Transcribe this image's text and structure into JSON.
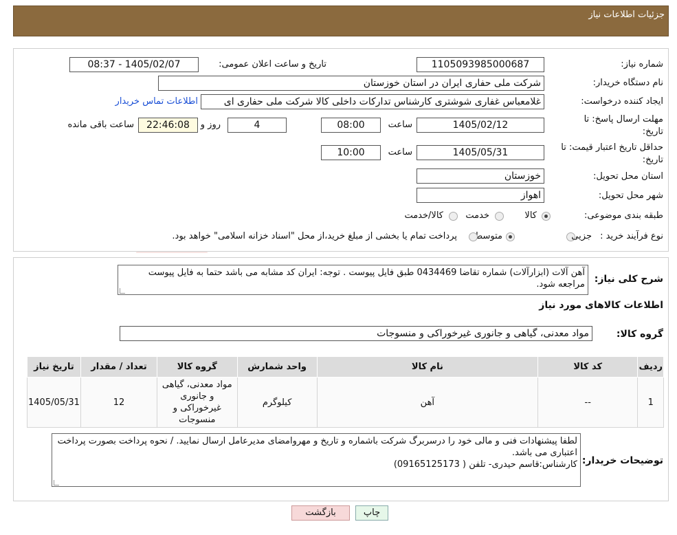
{
  "header": {
    "title": "جزئیات اطلاعات نیاز"
  },
  "form": {
    "need_number_label": "شماره نیاز:",
    "need_number": "1105093985000687",
    "announce_label": "تاریخ و ساعت اعلان عمومی:",
    "announce_value": "1405/02/07 - 08:37",
    "buyer_label": "نام دستگاه خریدار:",
    "buyer_value": "شرکت ملی حفاری ایران در استان خوزستان",
    "creator_label": "ایجاد کننده درخواست:",
    "creator_value": "غلامعباس غفاری شوشتری کارشناس تدارکات داخلی کالا شرکت ملی حفاری ای",
    "contact_link": "اطلاعات تماس خریدار",
    "reply_deadline_label": "مهلت ارسال پاسخ: تا تاریخ:",
    "reply_date": "1405/02/12",
    "time_label": "ساعت",
    "reply_time": "08:00",
    "days_value": "4",
    "days_label": "روز و",
    "remaining_time": "22:46:08",
    "remaining_label": "ساعت باقی مانده",
    "price_validity_label": "حداقل تاریخ اعتبار قیمت: تا تاریخ:",
    "price_date": "1405/05/31",
    "price_time": "10:00",
    "province_label": "استان محل تحویل:",
    "province_value": "خوزستان",
    "city_label": "شهر محل تحویل:",
    "city_value": "اهواز",
    "category_label": "طبقه بندی موضوعی:",
    "category_options": [
      "کالا",
      "خدمت",
      "کالا/خدمت"
    ],
    "process_label": "نوع فرآیند خرید :",
    "process_options": [
      "جزیی",
      "متوسط"
    ],
    "process_note": "پرداخت تمام یا بخشی از مبلغ خرید،از محل \"اسناد خزانه اسلامی\" خواهد بود."
  },
  "summary": {
    "label": "شرح کلی نیاز:",
    "text": "آهن آلات (ابزارآلات)  شماره تقاضا 0434469 طبق فایل پیوست . توجه: ایران کد مشابه می باشد حتما به فایل پیوست مراجعه شود."
  },
  "goods": {
    "section_title": "اطلاعات کالاهای مورد نیاز",
    "group_label": "گروه کالا:",
    "group_value": "مواد معدنی، گیاهی و جانوری غیرخوراکی و منسوجات",
    "columns": [
      "ردیف",
      "کد کالا",
      "نام کالا",
      "واحد شمارش",
      "گروه کالا",
      "تعداد / مقدار",
      "تاریخ نیاز"
    ],
    "rows": [
      {
        "row": "1",
        "code": "--",
        "name": "آهن",
        "unit": "کیلوگرم",
        "group": "مواد معدنی، گیاهی و جانوری غیرخوراکی و منسوجات",
        "qty": "12",
        "date": "1405/05/31"
      }
    ]
  },
  "buyer_notes": {
    "label": "توضیحات خریدار:",
    "line1": "لطفا پیشنهادات فنی و مالی خود را درسربرگ شرکت باشماره و تاریخ و مهروامضای مدیرعامل ارسال نمایید. / نحوه پرداخت بصورت پرداخت اعتباری می باشد.",
    "line2": "کارشناس:قاسم حیدری- تلفن ( 09165125173)"
  },
  "buttons": {
    "print": "چاپ",
    "back": "بازگشت"
  },
  "colors": {
    "header_bg": "#8b6a3e",
    "link": "#1a4fd6",
    "back_btn": "#f7d9d9",
    "print_btn": "#e6f7e9"
  }
}
